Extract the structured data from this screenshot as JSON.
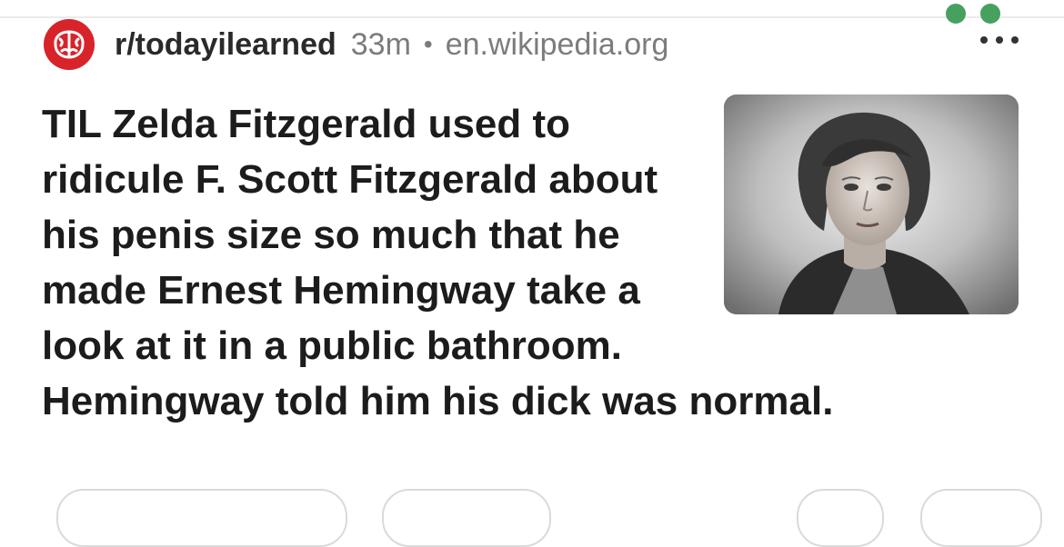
{
  "post": {
    "subreddit": "r/todayilearned",
    "age": "33m",
    "separator": "•",
    "domain": "en.wikipedia.org",
    "title": "TIL Zelda Fitzgerald used to ridicule F. Scott Fitzgerald about his penis size so much that he made Ernest Hemingway take a look at it in a public bathroom. Hemingway told him his dick was normal."
  },
  "icons": {
    "subreddit_icon": "brain-icon",
    "more": "more-options-icon"
  },
  "colors": {
    "subreddit_icon_bg": "#d8232a",
    "meta_text": "#7c7c7c",
    "title_text": "#1c1c1c"
  }
}
